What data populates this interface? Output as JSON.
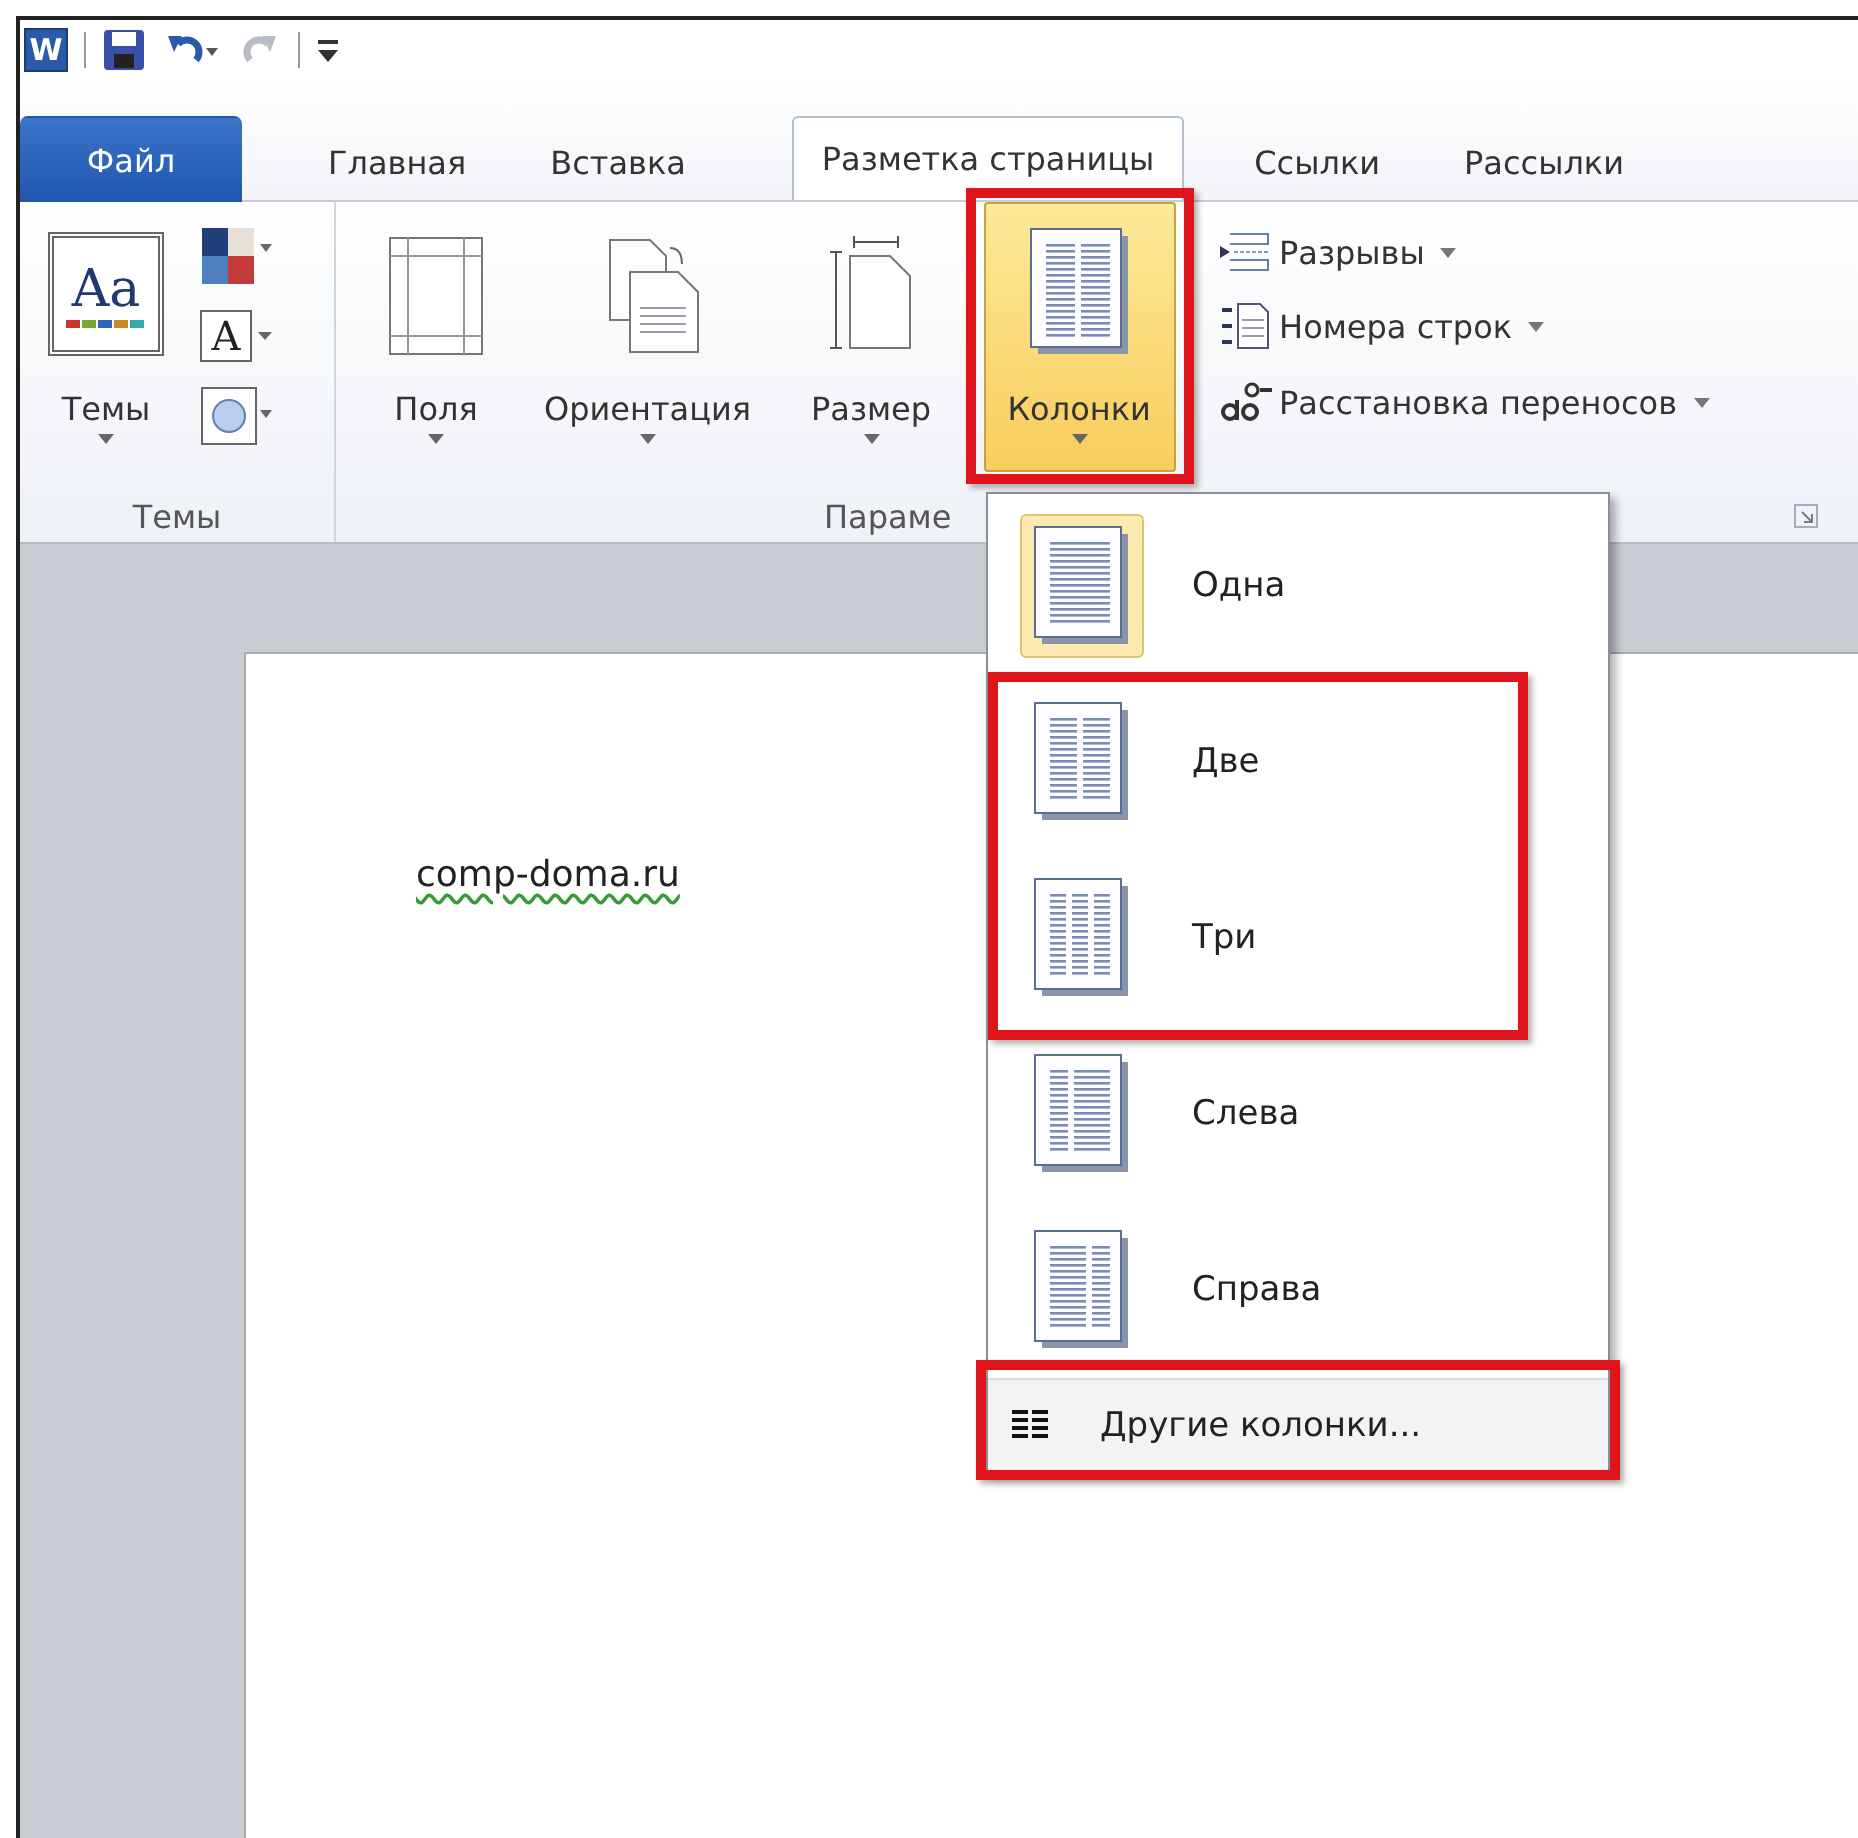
{
  "quick_access_toolbar": [
    {
      "kind": "app",
      "glyph": "W"
    },
    {
      "kind": "save",
      "disabled": false
    },
    {
      "kind": "undo",
      "disabled": false
    },
    {
      "kind": "redo",
      "disabled": true
    },
    {
      "kind": "customize",
      "disabled": false
    }
  ],
  "tabs": [
    {
      "label": "Файл",
      "kind": "file",
      "selected": false
    },
    {
      "label": "Главная",
      "kind": "tab",
      "selected": false
    },
    {
      "label": "Вставка",
      "kind": "tab",
      "selected": false
    },
    {
      "label": "Разметка страницы",
      "kind": "tab",
      "selected": true
    },
    {
      "label": "Ссылки",
      "kind": "tab",
      "selected": false
    },
    {
      "label": "Рассылки",
      "kind": "tab",
      "selected": false
    }
  ],
  "ribbon": {
    "groups": [
      {
        "label": "Темы",
        "launcher": false,
        "items": [
          {
            "kind": "large",
            "label": "Темы",
            "glyph": "Aa",
            "dropdown": true,
            "pressed": false
          },
          {
            "kind": "column",
            "items": [
              {
                "kind": "colors"
              },
              {
                "kind": "fonts",
                "glyph": "A"
              },
              {
                "kind": "effects"
              }
            ]
          }
        ]
      },
      {
        "label": "Параме",
        "launcher": true,
        "items": [
          {
            "kind": "large",
            "label": "Поля",
            "dropdown": true,
            "pressed": false
          },
          {
            "kind": "large",
            "label": "Ориентация",
            "dropdown": true,
            "pressed": false
          },
          {
            "kind": "large",
            "label": "Размер",
            "dropdown": true,
            "pressed": false
          },
          {
            "kind": "large",
            "label": "Колонки",
            "dropdown": true,
            "pressed": true
          },
          {
            "kind": "list",
            "items": [
              {
                "label": "Разрывы"
              },
              {
                "label": "Номера строк"
              },
              {
                "label": "Расстановка переносов"
              }
            ]
          }
        ]
      }
    ]
  },
  "document": {
    "text": "comp-doma.ru",
    "grammar_marked": true
  },
  "columns_menu": {
    "items": [
      {
        "label": "Одна",
        "selected": true
      },
      {
        "label": "Две",
        "selected": false
      },
      {
        "label": "Три",
        "selected": false
      },
      {
        "label": "Слева",
        "selected": false
      },
      {
        "label": "Справа",
        "selected": false
      }
    ],
    "footer": {
      "label": "Другие колонки..."
    }
  }
}
